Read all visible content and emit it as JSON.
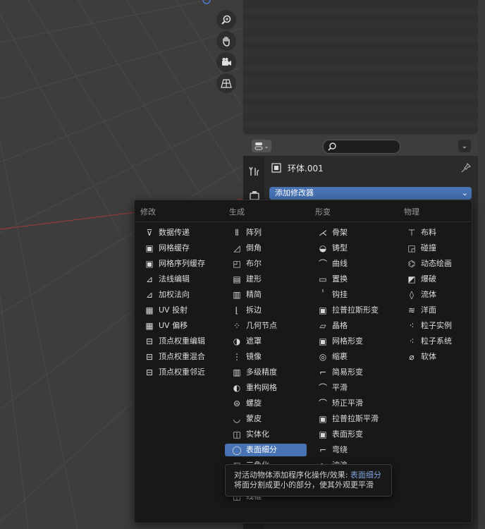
{
  "properties": {
    "object_name": "环体.001",
    "add_modifier_label": "添加修改器"
  },
  "menu": {
    "columns": [
      {
        "header": "修改",
        "items": [
          "数据传递",
          "网格缓存",
          "网格序列缓存",
          "法线编辑",
          "加权法向",
          "UV 投射",
          "UV 偏移",
          "顶点权重编辑",
          "顶点权重混合",
          "顶点权重邻近"
        ]
      },
      {
        "header": "生成",
        "items": [
          "阵列",
          "倒角",
          "布尔",
          "建形",
          "精简",
          "拆边",
          "几何节点",
          "遮罩",
          "镜像",
          "多级精度",
          "重构网格",
          "螺旋",
          "蒙皮",
          "实体化",
          "表面细分",
          "三角化",
          "焊接",
          "线框"
        ]
      },
      {
        "header": "形变",
        "items": [
          "骨架",
          "铸型",
          "曲线",
          "置换",
          "钩挂",
          "拉普拉斯形变",
          "晶格",
          "网格形变",
          "缩裹",
          "简易形变",
          "平滑",
          "矫正平滑",
          "拉普拉斯平滑",
          "表面形变",
          "弯绕",
          "波浪"
        ]
      },
      {
        "header": "物理",
        "items": [
          "布料",
          "碰撞",
          "动态绘画",
          "爆破",
          "流体",
          "洋面",
          "粒子实例",
          "粒子系统",
          "软体"
        ]
      }
    ],
    "active_item": "表面细分"
  },
  "tooltip": {
    "line1_prefix": "对活动物体添加程序化操作/效果: ",
    "line1_highlight": "表面细分",
    "line2": "将面分割成更小的部分，使其外观更平滑"
  },
  "colors": {
    "accent": "#4772b3",
    "menu_bg": "#181818",
    "highlight_text": "#7fa2d8"
  }
}
